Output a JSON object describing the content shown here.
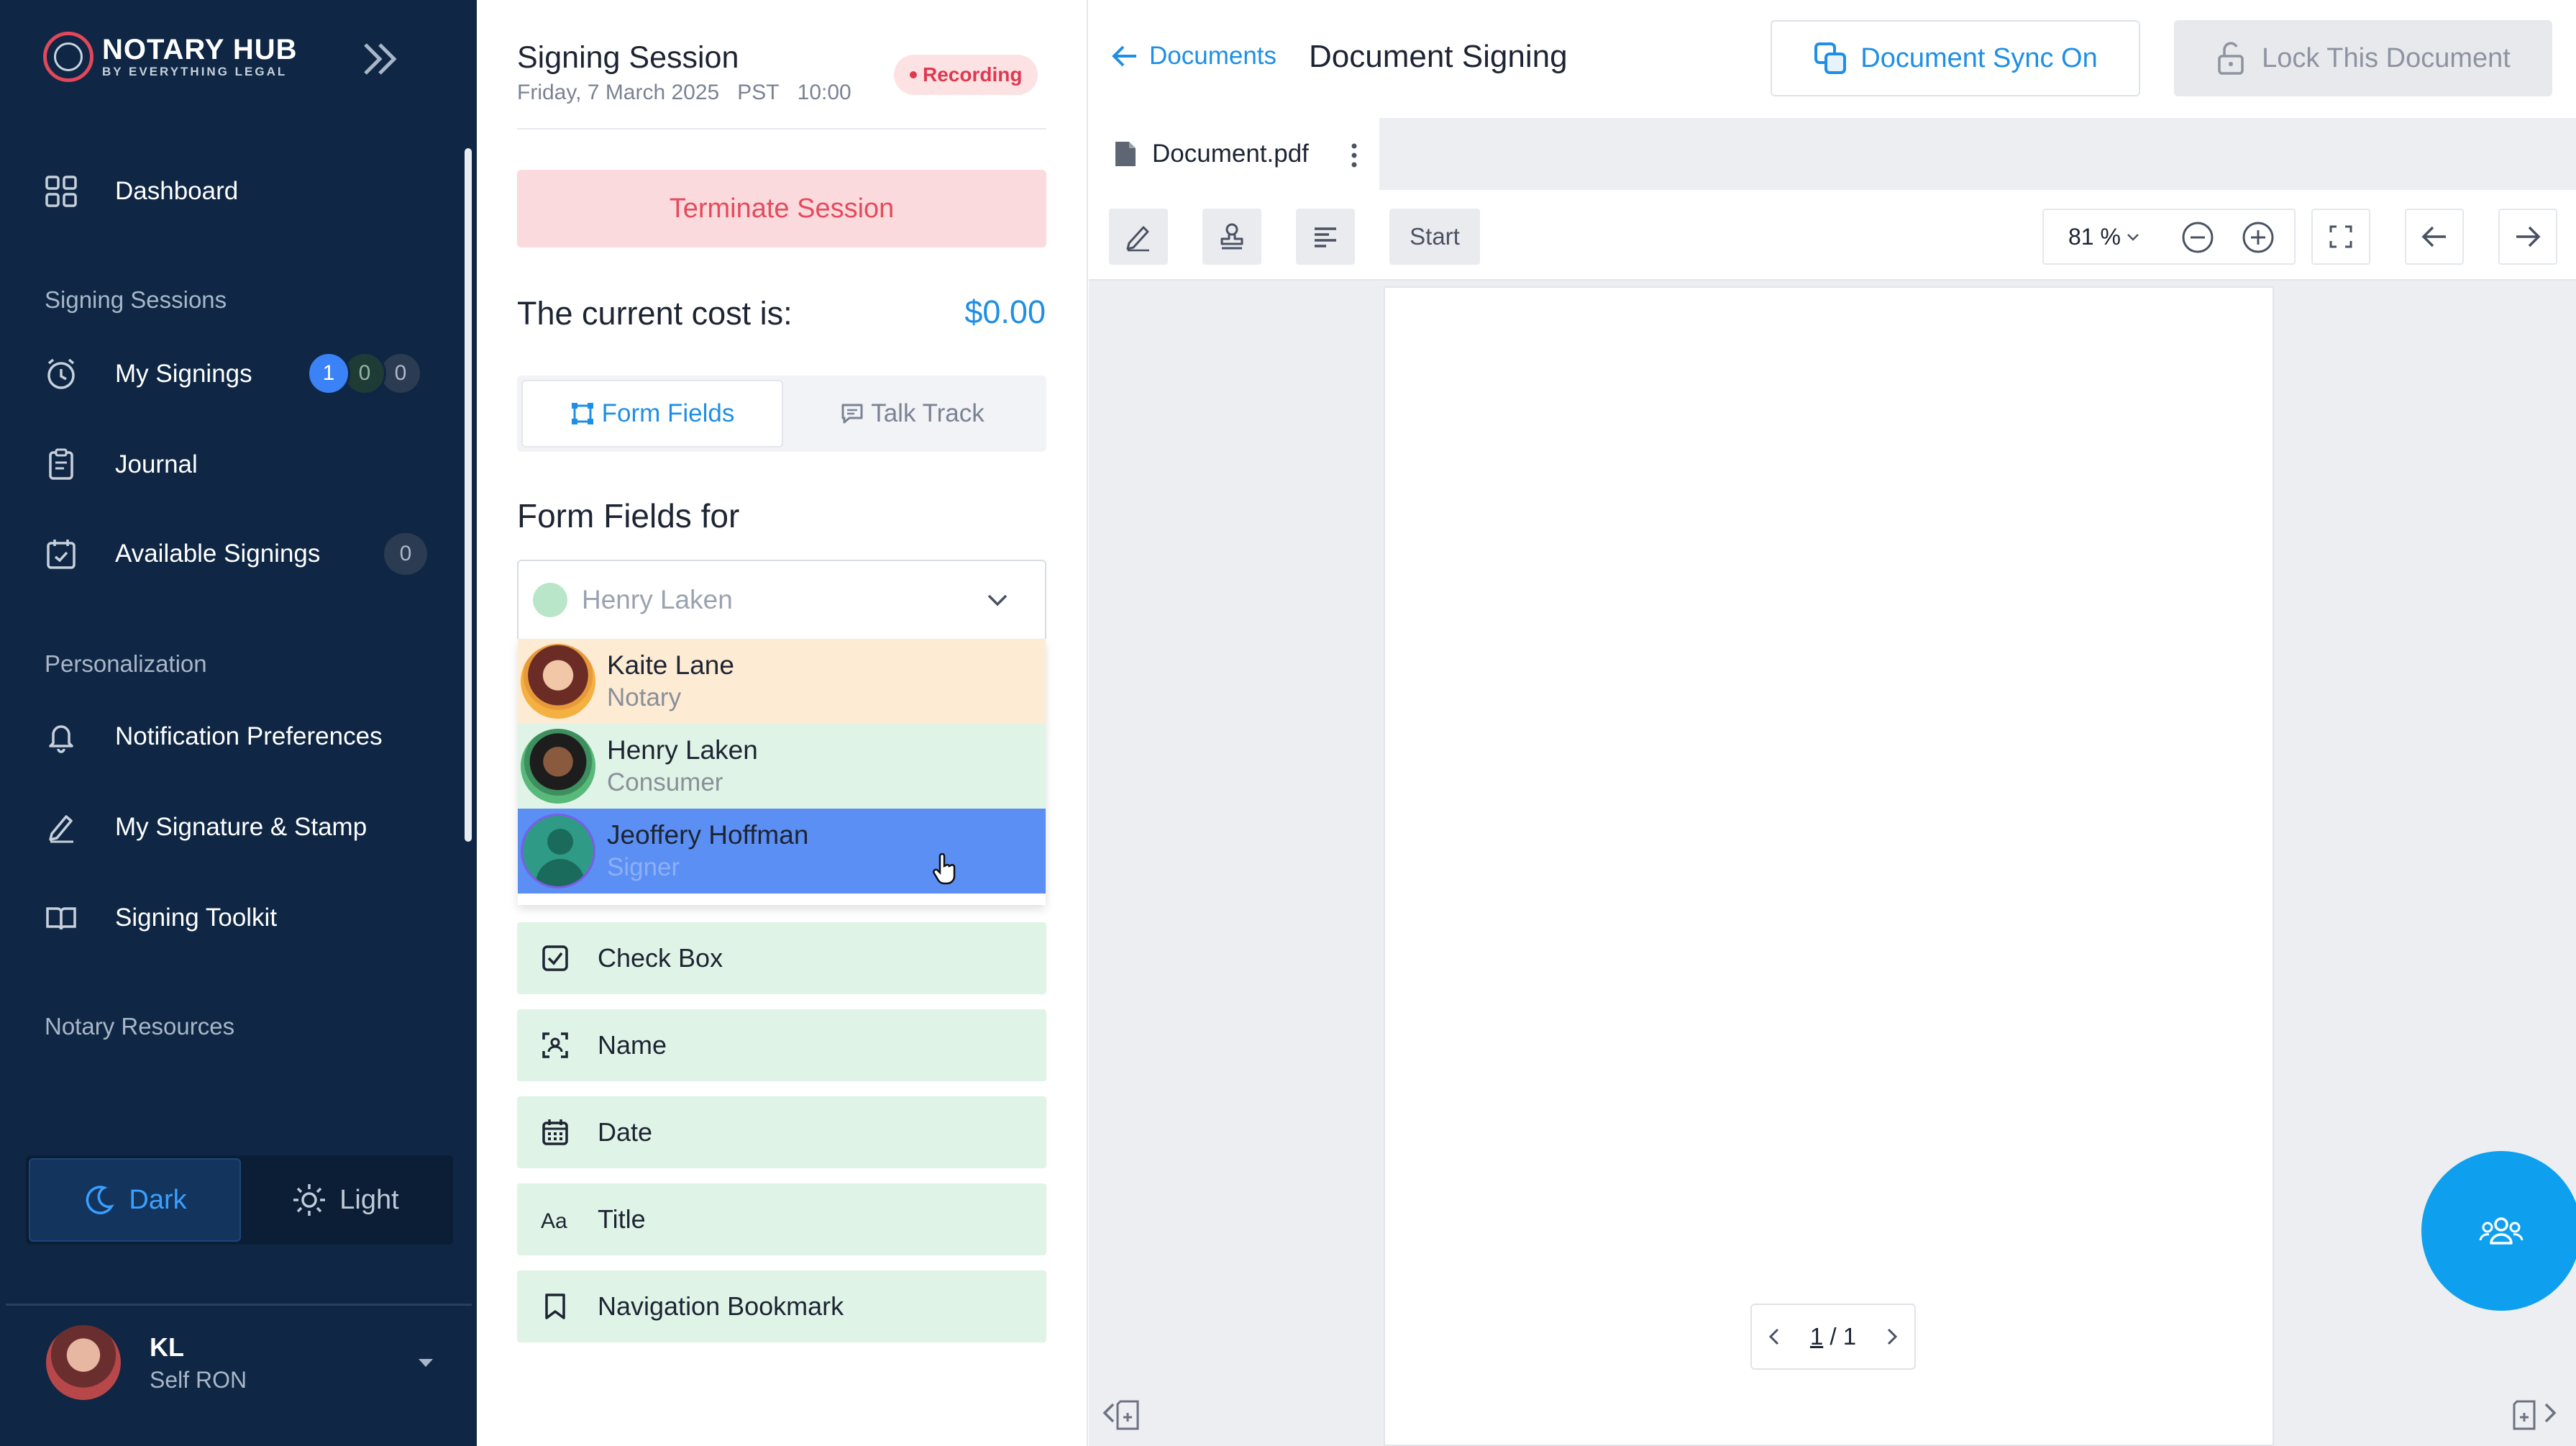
{
  "brand": {
    "title": "NOTARY HUB",
    "subtitle": "BY EVERYTHING LEGAL",
    "accent": "#e2475b"
  },
  "sidebar": {
    "dashboard": "Dashboard",
    "sections": {
      "signing": "Signing Sessions",
      "personalization": "Personalization",
      "resources": "Notary Resources"
    },
    "items": {
      "my_signings": "My Signings",
      "journal": "Journal",
      "available_signings": "Available Signings",
      "notification_prefs": "Notification Preferences",
      "signature_stamp": "My Signature & Stamp",
      "signing_toolkit": "Signing Toolkit"
    },
    "my_signings_badges": [
      "1",
      "0",
      "0"
    ],
    "available_count": "0",
    "theme": {
      "dark": "Dark",
      "light": "Light",
      "selected": "Dark"
    },
    "user": {
      "initials": "KL",
      "role": "Self RON"
    }
  },
  "session": {
    "title": "Signing Session",
    "date": "Friday, 7 March 2025",
    "timezone": "PST",
    "time": "10:00",
    "status": "Recording",
    "terminate_label": "Terminate Session",
    "cost_label": "The current cost is:",
    "cost_value": "$0.00"
  },
  "tabs": [
    {
      "label": "Form Fields",
      "active": true
    },
    {
      "label": "Talk Track",
      "active": false
    }
  ],
  "form_fields": {
    "heading": "Form Fields for",
    "selected_participant": "Henry Laken",
    "participants": [
      {
        "name": "Kaite Lane",
        "role": "Notary",
        "color": "#fdebd3"
      },
      {
        "name": "Henry Laken",
        "role": "Consumer",
        "color": "#dff3e6"
      },
      {
        "name": "Jeoffery Hoffman",
        "role": "Signer",
        "color": "#5b8ff3"
      }
    ],
    "fields": [
      "Check Box",
      "Name",
      "Date",
      "Title",
      "Navigation Bookmark"
    ]
  },
  "document": {
    "back_label": "Documents",
    "title": "Document Signing",
    "sync_label": "Document Sync On",
    "lock_label": "Lock This Document",
    "file_name": "Document.pdf",
    "start_label": "Start",
    "zoom": "81 %",
    "page_current": "1",
    "page_total": "1"
  },
  "colors": {
    "primary": "#1f8fe5",
    "sidebar_bg": "#0f2744",
    "field_bg": "#dff3e6",
    "fab": "#0ea0ef"
  }
}
